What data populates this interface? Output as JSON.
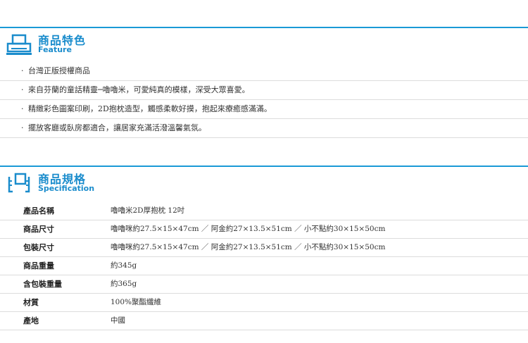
{
  "feature": {
    "title": "商品特色",
    "subtitle": "Feature",
    "icon": "printer-icon",
    "items": [
      "台灣正版授權商品",
      "來自芬蘭的童話精靈─嚕嚕米，可愛純真的模樣，深受大眾喜愛。",
      "精緻彩色圖案印刷，2D抱枕造型，觸感柔軟好摸，抱起來療癒感滿滿。",
      "擺放客廳或臥房都適合，讓居家充滿活潑溫馨氣氛。"
    ]
  },
  "specification": {
    "title": "商品規格",
    "subtitle": "Specification",
    "icon": "ruler-frame-icon",
    "rows": [
      {
        "key": "產品名稱",
        "value": "嚕嚕米2D厚抱枕 12吋"
      },
      {
        "key": "商品尺寸",
        "value": "嚕嚕咪約27.5×15×47cm ／ 阿金約27×13.5×51cm ／ 小不點約30×15×50cm"
      },
      {
        "key": "包裝尺寸",
        "value": "嚕嚕咪約27.5×15×47cm ／ 阿金約27×13.5×51cm ／ 小不點約30×15×50cm"
      },
      {
        "key": "商品重量",
        "value": "約345g"
      },
      {
        "key": "含包裝重量",
        "value": "約365g"
      },
      {
        "key": "材質",
        "value": "100%聚酯纖維"
      },
      {
        "key": "產地",
        "value": "中國"
      }
    ]
  },
  "colors": {
    "accent": "#1a9ad6",
    "divider": "#dcdcdc"
  }
}
